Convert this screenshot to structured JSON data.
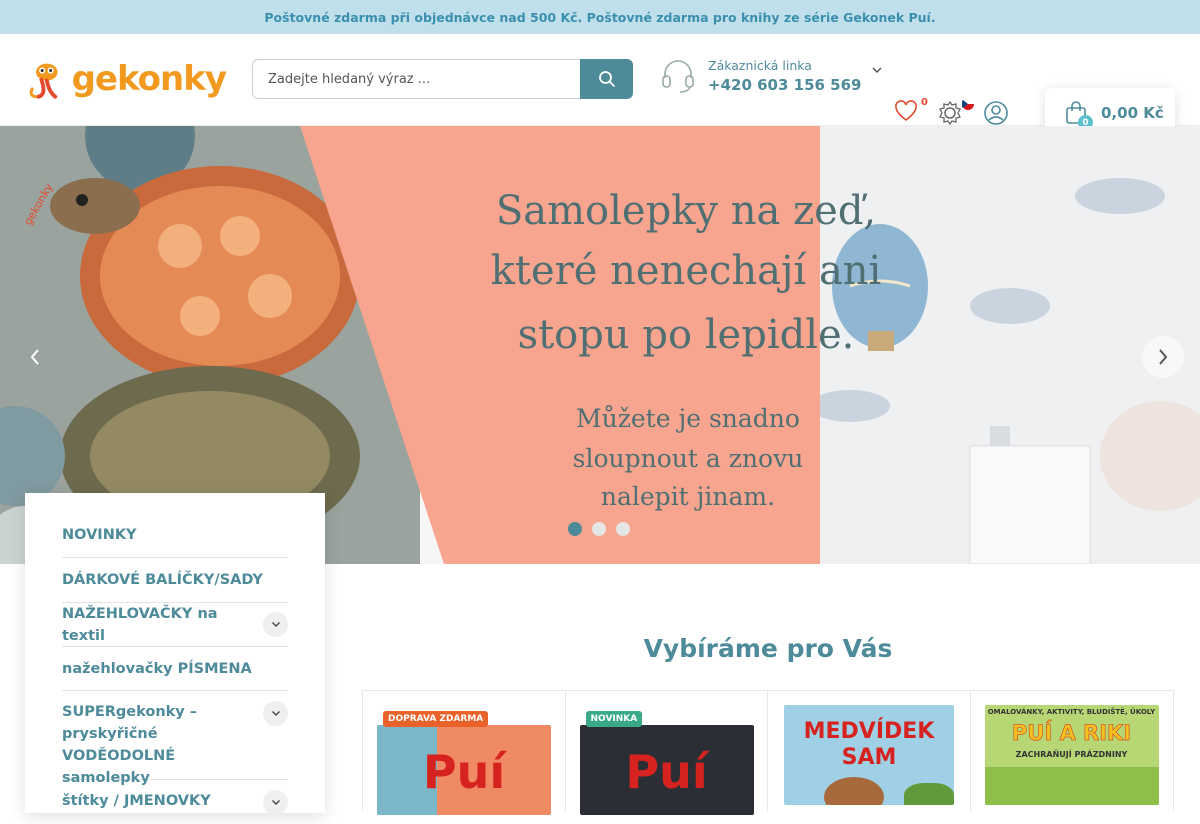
{
  "topbar": {
    "text": "Poštovné zdarma při objednávce nad 500 Kč. Poštovné zdarma pro knihy ze série Gekonek Puí."
  },
  "header": {
    "logo_text": "gekonky",
    "search_placeholder": "Zadejte hledaný výraz ...",
    "hotline_label": "Zákaznická linka",
    "hotline_phone": "+420 603 156 569",
    "wishlist_count": "0",
    "cart_count": "0",
    "cart_total": "0,00 Kč"
  },
  "hero": {
    "line1": "Samolepky na zeď,",
    "line2": "které nenechají ani",
    "line3": "stopu po lepidle.",
    "line4": "Můžete je snadno",
    "line5": "sloupnout a znovu",
    "line6": "nalepit jinam.",
    "image_label": "gekonky",
    "slides": 3,
    "active_slide": 1
  },
  "sidebar": {
    "items": [
      {
        "label": "NOVINKY",
        "has_children": false
      },
      {
        "label": "DÁRKOVÉ BALÍČKY/SADY",
        "has_children": false
      },
      {
        "label": "NAŽEHLOVAČKY na textil",
        "has_children": true
      },
      {
        "label": "nažehlovačky PÍSMENA",
        "has_children": false
      },
      {
        "label": "SUPERgekonky – pryskyřičné VODĚODOLNÉ samolepky",
        "has_children": true
      },
      {
        "label": "štítky / JMENOVKY",
        "has_children": true
      }
    ]
  },
  "section": {
    "title": "Vybíráme pro Vás"
  },
  "products": [
    {
      "badge": "DOPRAVA ZDARMA",
      "badge_color": "#e8622a",
      "cover_title": "Puí"
    },
    {
      "badge": "NOVINKA",
      "badge_color": "#3aa98a",
      "cover_title": "Puí"
    },
    {
      "badge": "",
      "badge_color": "",
      "cover_title": "MEDVÍDEK SAM"
    },
    {
      "badge": "",
      "badge_color": "",
      "cover_top": "OMALOVÁNKY, AKTIVITY, BLUDIŠTĚ, ÚKOLY",
      "cover_title": "PUÍ A RIKI",
      "cover_sub": "ZACHRAŇUJÍ PRÁZDNINY"
    }
  ],
  "colors": {
    "accent": "#4e8b9a",
    "topbar_bg": "#bfe0ea",
    "badge_red": "#e4492c",
    "logo_orange": "#f29a1f"
  }
}
